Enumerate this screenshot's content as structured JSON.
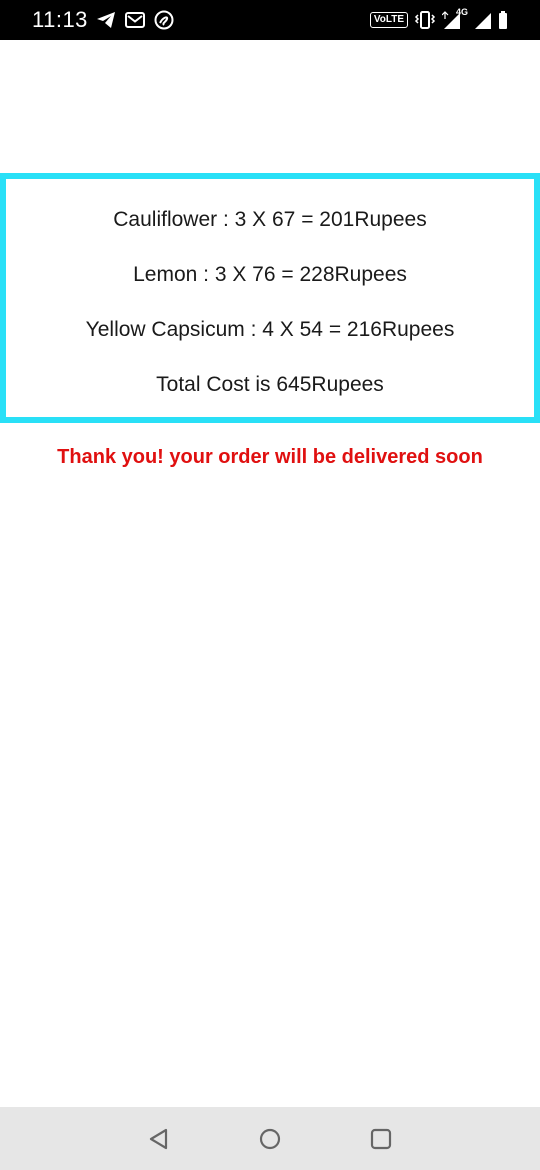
{
  "status_bar": {
    "time": "11:13",
    "left_icons": [
      "telegram-icon",
      "gmail-icon",
      "airtel-icon"
    ],
    "volte_label": "VoLTE",
    "network_label": "4G",
    "right_icons": [
      "volte-icon",
      "vibrate-icon",
      "signal-icon",
      "signal-icon",
      "battery-icon"
    ]
  },
  "order": {
    "items": [
      {
        "text": "Cauliflower : 3 X 67 = 201Rupees"
      },
      {
        "text": "Lemon : 3 X 76 = 228Rupees"
      },
      {
        "text": "Yellow Capsicum : 4 X 54 = 216Rupees"
      }
    ],
    "total_text": "Total Cost is 645Rupees",
    "border_color": "#29e0f7"
  },
  "message": {
    "text": "Thank you! your order will be delivered soon",
    "color": "#e01010"
  },
  "nav_bar": {
    "buttons": [
      "back-icon",
      "home-icon",
      "recents-icon"
    ]
  }
}
